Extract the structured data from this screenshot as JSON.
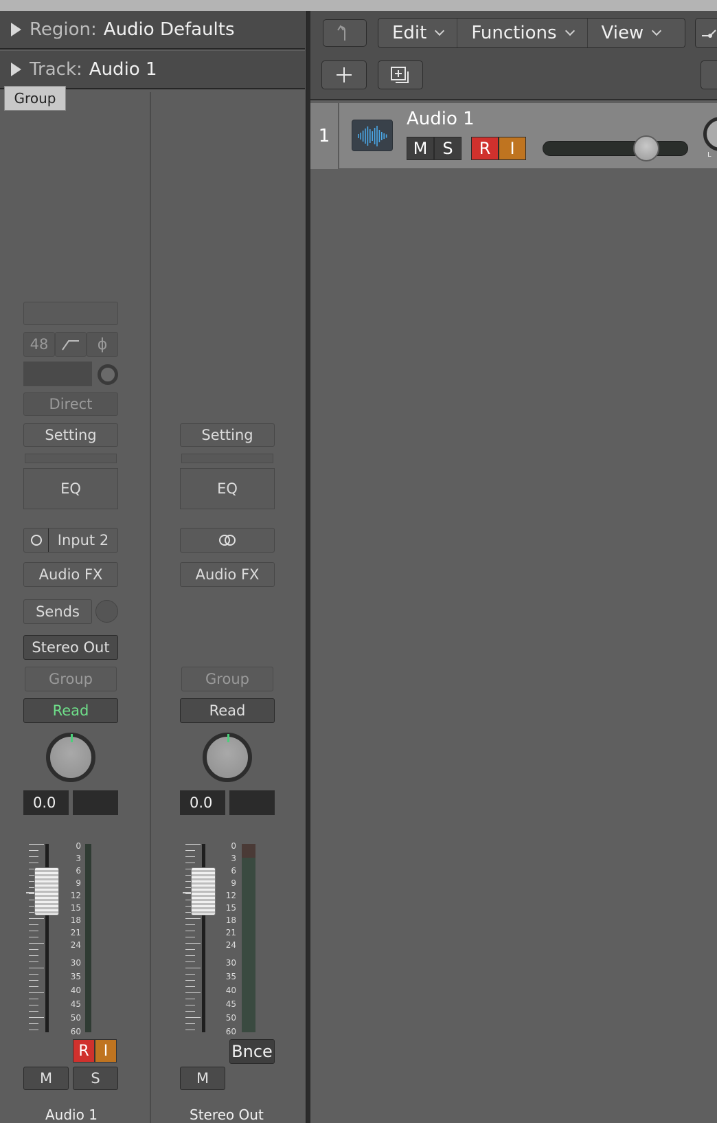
{
  "inspector": {
    "region_label": "Region:",
    "region_value": "Audio Defaults",
    "track_label": "Track:",
    "track_value": "Audio 1",
    "tooltip": "Group"
  },
  "strip1": {
    "gain_value": "48",
    "filter_icon": "low-cut-icon",
    "phase_icon": "phase-invert-icon",
    "direct": "Direct",
    "setting": "Setting",
    "eq": "EQ",
    "input": "Input 2",
    "audio_fx": "Audio FX",
    "sends": "Sends",
    "output": "Stereo Out",
    "group": "Group",
    "automation": "Read",
    "volume": "0.0",
    "record": "R",
    "input_monitor": "I",
    "mute": "M",
    "solo": "S",
    "name": "Audio 1"
  },
  "strip2": {
    "setting": "Setting",
    "eq": "EQ",
    "link_icon": "stereo-link-icon",
    "audio_fx": "Audio FX",
    "group": "Group",
    "automation": "Read",
    "volume": "0.0",
    "bounce": "Bnce",
    "mute": "M",
    "name": "Stereo Out"
  },
  "meter_scale": [
    "0",
    "3",
    "6",
    "9",
    "12",
    "15",
    "18",
    "21",
    "24",
    "30",
    "35",
    "40",
    "45",
    "50",
    "60"
  ],
  "toolbar": {
    "back_icon": "back-arrow-icon",
    "edit": "Edit",
    "functions": "Functions",
    "view": "View",
    "add_icon": "plus-icon",
    "folder_icon": "add-folder-icon"
  },
  "track": {
    "number": "1",
    "name": "Audio 1",
    "mute": "M",
    "solo": "S",
    "record": "R",
    "input_monitor": "I",
    "pan_label": "L"
  },
  "colors": {
    "record": "#d0312d",
    "input_monitor": "#bf7420",
    "read_active": "#6fe08a",
    "waveform": "#4aa8e8"
  }
}
